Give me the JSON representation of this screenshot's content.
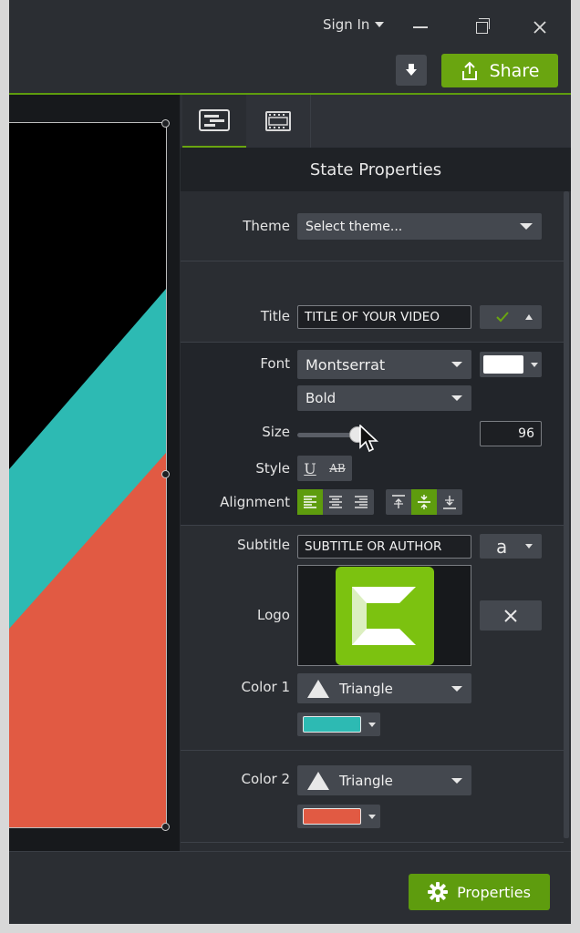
{
  "titlebar": {
    "sign_in_label": "Sign In",
    "share_label": "Share"
  },
  "panel": {
    "header_title": "State Properties",
    "theme": {
      "label": "Theme",
      "value": "Select theme..."
    },
    "title": {
      "label": "Title",
      "value": "TITLE OF YOUR VIDEO"
    },
    "font": {
      "label": "Font",
      "family": "Montserrat",
      "weight": "Bold",
      "color": "#ffffff"
    },
    "size": {
      "label": "Size",
      "value": "96",
      "slider_level": 0.85
    },
    "style": {
      "label": "Style",
      "underline_glyph": "U",
      "strike_glyph": "AB"
    },
    "alignment": {
      "label": "Alignment",
      "horizontal_selected": "left",
      "vertical_selected": "middle"
    },
    "subtitle": {
      "label": "Subtitle",
      "value": "SUBTITLE OR AUTHOR",
      "font_glyph": "a"
    },
    "logo": {
      "label": "Logo"
    },
    "color1": {
      "label": "Color 1",
      "shape": "Triangle",
      "color": "#2dbab3"
    },
    "color2": {
      "label": "Color 2",
      "shape": "Triangle",
      "color": "#e15a43"
    }
  },
  "canvas": {
    "colors": {
      "background": "#000000",
      "teal": "#2dbab3",
      "orange": "#e15a43"
    }
  },
  "bottom": {
    "properties_label": "Properties"
  },
  "colors": {
    "accent_green": "#6aa510",
    "logo_green": "#7cc210"
  }
}
